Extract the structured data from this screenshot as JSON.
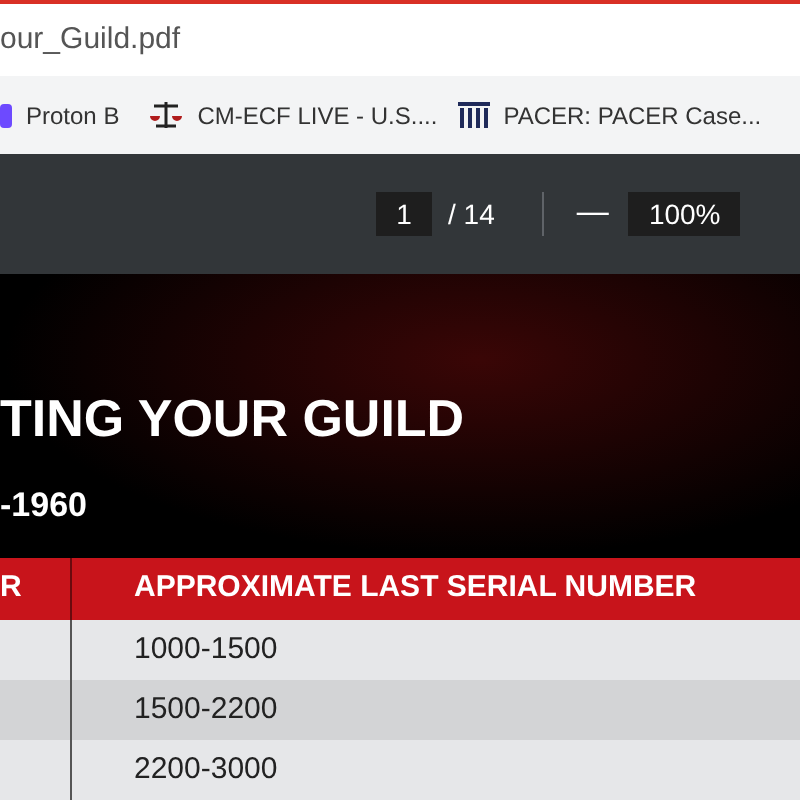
{
  "address_bar": {
    "url": "our_Guild.pdf"
  },
  "bookmarks": [
    {
      "kind": "proton",
      "label": "Proton B"
    },
    {
      "kind": "scales",
      "label": "CM-ECF LIVE - U.S...."
    },
    {
      "kind": "pillars",
      "label": "PACER: PACER Case..."
    }
  ],
  "pdf_toolbar": {
    "page": "1",
    "page_count": "/ 14",
    "zoom_out": "—",
    "zoom": "100%"
  },
  "document": {
    "title": "TING YOUR GUILD",
    "subtitle": "-1960",
    "table": {
      "columns": [
        "R",
        "APPROXIMATE LAST SERIAL NUMBER"
      ],
      "rows": [
        {
          "column_2": "1000-1500"
        },
        {
          "column_2": "1500-2200"
        },
        {
          "column_2": "2200-3000"
        }
      ]
    }
  }
}
